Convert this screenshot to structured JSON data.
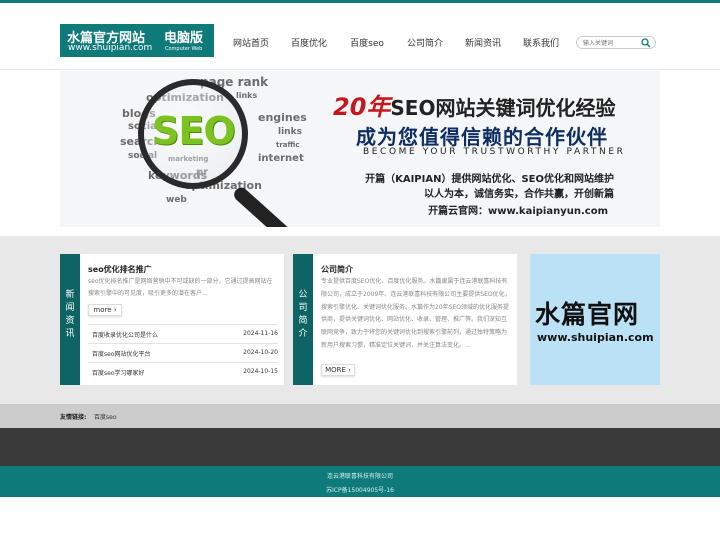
{
  "header": {
    "logo_title": "水篇官方网站",
    "logo_badge": "电脑版",
    "logo_url": "www.shuipian.com",
    "logo_sub": "Computer Web",
    "nav": [
      "网站首页",
      "百度优化",
      "百度seo",
      "公司简介",
      "新闻资讯",
      "联系我们"
    ],
    "search_placeholder": "输入关键词"
  },
  "banner": {
    "headline_num": "20年",
    "headline_rest": "SEO网站关键词优化经验",
    "line2": "成为您值得信赖的合作伙伴",
    "line3": "BECOME YOUR TRUSTWORTHY PARTNER",
    "line4": "开篇（KAIPIAN）提供网站优化、SEO优化和网站维护",
    "line5": "以人为本，诚信务实，合作共赢，开创新篇",
    "line6": "开篇云官网：www.kaipianyun.com",
    "seo_word": "SEO",
    "cloud_words": [
      "page rank",
      "optimization",
      "links",
      "blogs",
      "social",
      "search",
      "keywords",
      "engines",
      "internet",
      "marketing",
      "traffic",
      "links",
      "social",
      "pr",
      "optimization",
      "web"
    ]
  },
  "news_panel": {
    "side_label": [
      "新",
      "闻",
      "资",
      "讯"
    ],
    "title": "seo优化排名推广",
    "desc": "seo优化排名推广是网络营销中不可或缺的一部分，它通过提高网站在搜索引擎中的可见度，吸引更多的潜在客户...",
    "more": "more",
    "items": [
      {
        "title": "百度收录优化公司是什么",
        "date": "2024-11-16"
      },
      {
        "title": "百度seo网站优化平台",
        "date": "2024-10-20"
      },
      {
        "title": "百度seo学习哪家好",
        "date": "2024-10-15"
      }
    ]
  },
  "about_panel": {
    "side_label": [
      "公",
      "司",
      "简",
      "介"
    ],
    "title": "公司简介",
    "desc": "专业提供百度SEO优化、百度优化服务。水篇隶属于连云港联喜科技有限公司，成立于2009年。连云港联喜科技有限公司主要提供SEO优化，搜索引擎优化、关键词优化服务。水篇作为20年SEO领域的优化服务提供商，提供关键词优化、网站优化、收录、管理、推广等。我们深知互联网竞争，致力于将您的关键词优化到搜索引擎前列，通过独特策略为新用户搜索习惯，精准定位关键词，并关注算法变化。...",
    "more": "MORE"
  },
  "side_ad": {
    "big": "水篇官网",
    "url": "www.shuipian.com"
  },
  "links": {
    "label": "友情链接:",
    "items": [
      "百度seo"
    ]
  },
  "footer": {
    "company": "连云港联喜科技有限公司",
    "icp": "苏ICP备15004905号-16"
  },
  "colors": {
    "brand": "#0e7a7a",
    "panel_side": "#0e6464",
    "seo_green": "#7dc31f",
    "headline_red": "#c8161d",
    "ad_bg": "#bbe1f6"
  }
}
